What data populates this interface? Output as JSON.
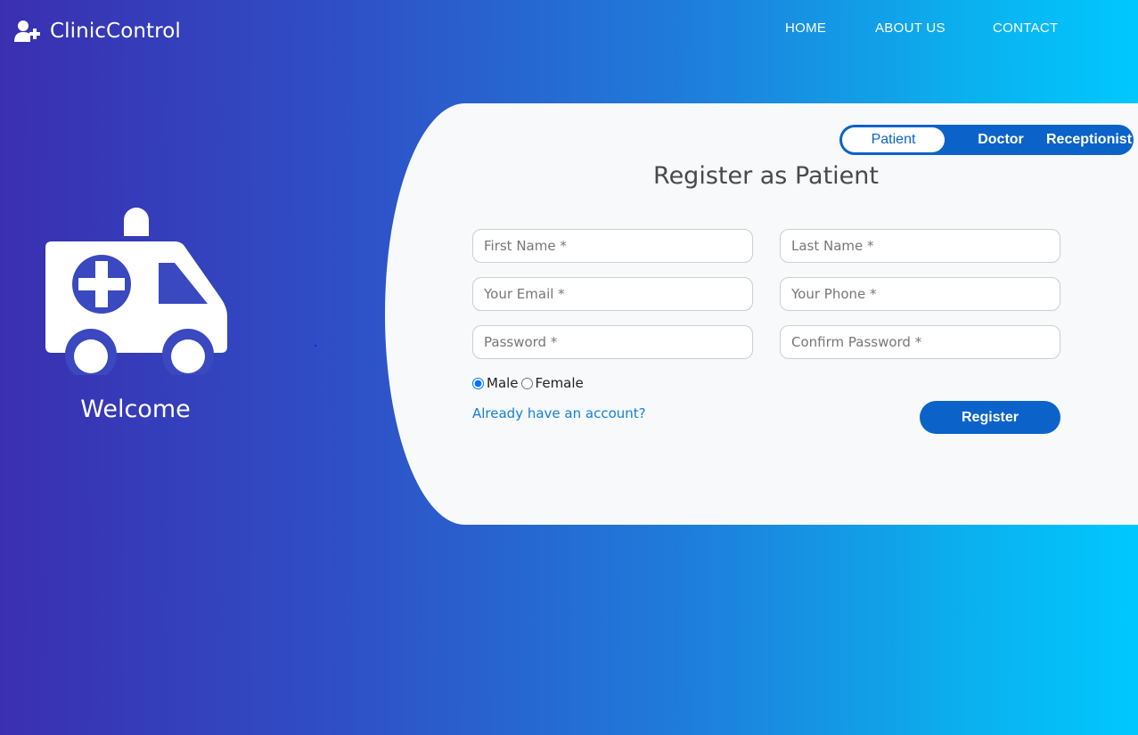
{
  "app": {
    "name": "ClinicControl"
  },
  "nav": {
    "home": "HOME",
    "about": "ABOUT US",
    "contact": "CONTACT"
  },
  "hero": {
    "welcome": "Welcome"
  },
  "roles": {
    "patient": "Patient",
    "doctor": "Doctor",
    "receptionist": "Receptionist",
    "active": "Patient"
  },
  "form": {
    "title": "Register as Patient",
    "first_name_placeholder": "First Name *",
    "last_name_placeholder": "Last Name *",
    "email_placeholder": "Your Email *",
    "phone_placeholder": "Your Phone *",
    "password_placeholder": "Password *",
    "confirm_password_placeholder": "Confirm Password *",
    "gender_male": "Male",
    "gender_female": "Female",
    "gender_selected": "Male",
    "login_link": "Already have an account?",
    "register_label": "Register"
  },
  "colors": {
    "accent": "#0b63c9",
    "link": "#1480d4",
    "card_bg": "#f7f9fb",
    "gradient_start": "#3a2fb0",
    "gradient_end": "#00c8ff"
  },
  "icons": {
    "brand": "user-plus-icon",
    "hero": "ambulance-icon"
  }
}
